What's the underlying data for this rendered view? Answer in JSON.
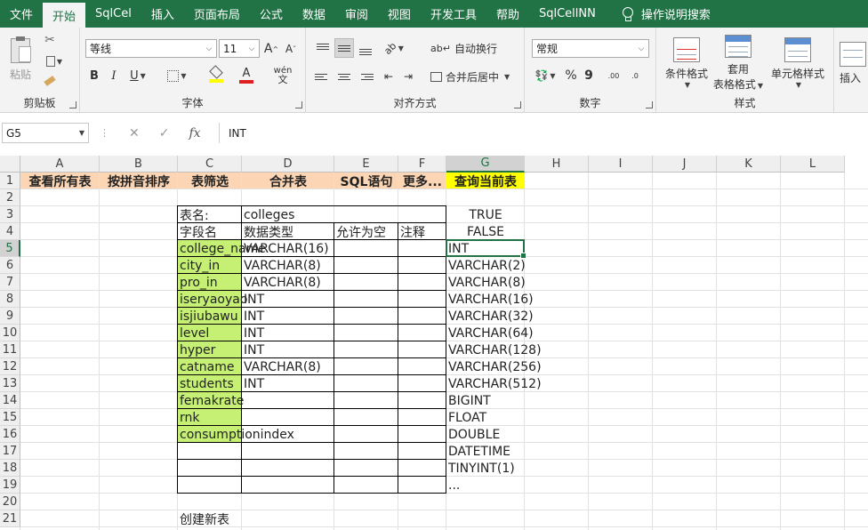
{
  "tabs": [
    "文件",
    "开始",
    "SqlCel",
    "插入",
    "页面布局",
    "公式",
    "数据",
    "审阅",
    "视图",
    "开发工具",
    "帮助",
    "SqlCellNN"
  ],
  "active_tab_index": 1,
  "tell_me": "操作说明搜索",
  "ribbon": {
    "clipboard": {
      "label": "剪贴板",
      "paste": "粘贴"
    },
    "font": {
      "label": "字体",
      "name": "等线",
      "size": "11",
      "grow": "A",
      "shrink": "A",
      "bold": "B",
      "italic": "I",
      "underline": "U",
      "font_color_letter": "A",
      "wen": "wén"
    },
    "alignment": {
      "label": "对齐方式",
      "wrap": "自动换行",
      "merge": "合并后居中"
    },
    "number": {
      "label": "数字",
      "format": "常规",
      "percent": "%",
      "comma": "9",
      "dec_inc": ".00",
      "dec_dec": ".0"
    },
    "styles": {
      "label": "样式",
      "conditional": "条件格式",
      "table_fmt_1": "套用",
      "table_fmt_2": "表格格式",
      "cell_styles": "单元格样式"
    },
    "insert": "插入"
  },
  "formula_bar": {
    "name_box": "G5",
    "fx": "fx",
    "cancel": "✕",
    "enter": "✓",
    "content": "INT"
  },
  "columns": [
    "A",
    "B",
    "C",
    "D",
    "E",
    "F",
    "G",
    "H",
    "I",
    "J",
    "K",
    "L"
  ],
  "rows": [
    "1",
    "2",
    "3",
    "4",
    "5",
    "6",
    "7",
    "8",
    "9",
    "10",
    "11",
    "12",
    "13",
    "14",
    "15",
    "16",
    "17",
    "18",
    "19",
    "20",
    "21"
  ],
  "header_buttons": [
    "查看所有表",
    "按拼音排序",
    "表筛选",
    "合并表",
    "SQL语句",
    "更多...",
    "查询当前表"
  ],
  "table": {
    "name_label": "表名:",
    "name_value": "colleges",
    "headers": [
      "字段名",
      "数据类型",
      "允许为空",
      "注释"
    ],
    "fields": [
      [
        "college_name",
        "VARCHAR(16)"
      ],
      [
        "city_in",
        "VARCHAR(8)"
      ],
      [
        "pro_in",
        "VARCHAR(8)"
      ],
      [
        "iseryaoyao",
        "INT"
      ],
      [
        "isjiubawu",
        "INT"
      ],
      [
        "level",
        "INT"
      ],
      [
        "hyper",
        "INT"
      ],
      [
        "catname",
        "VARCHAR(8)"
      ],
      [
        "students",
        "INT"
      ],
      [
        "femakrate",
        ""
      ],
      [
        "rnk",
        ""
      ],
      [
        "consumptionindex",
        ""
      ]
    ],
    "create_label": "创建新表"
  },
  "bool_options": [
    "TRUE",
    "FALSE"
  ],
  "type_list": [
    "INT",
    "VARCHAR(2)",
    "VARCHAR(8)",
    "VARCHAR(16)",
    "VARCHAR(32)",
    "VARCHAR(64)",
    "VARCHAR(128)",
    "VARCHAR(256)",
    "VARCHAR(512)",
    "BIGINT",
    "FLOAT",
    "DOUBLE",
    "DATETIME",
    "TINYINT(1)",
    "..."
  ],
  "colors": {
    "accent": "#217346",
    "header_fill": "#fcd5b4",
    "highlight_fill": "#ffff00",
    "field_fill": "#c5f074"
  }
}
